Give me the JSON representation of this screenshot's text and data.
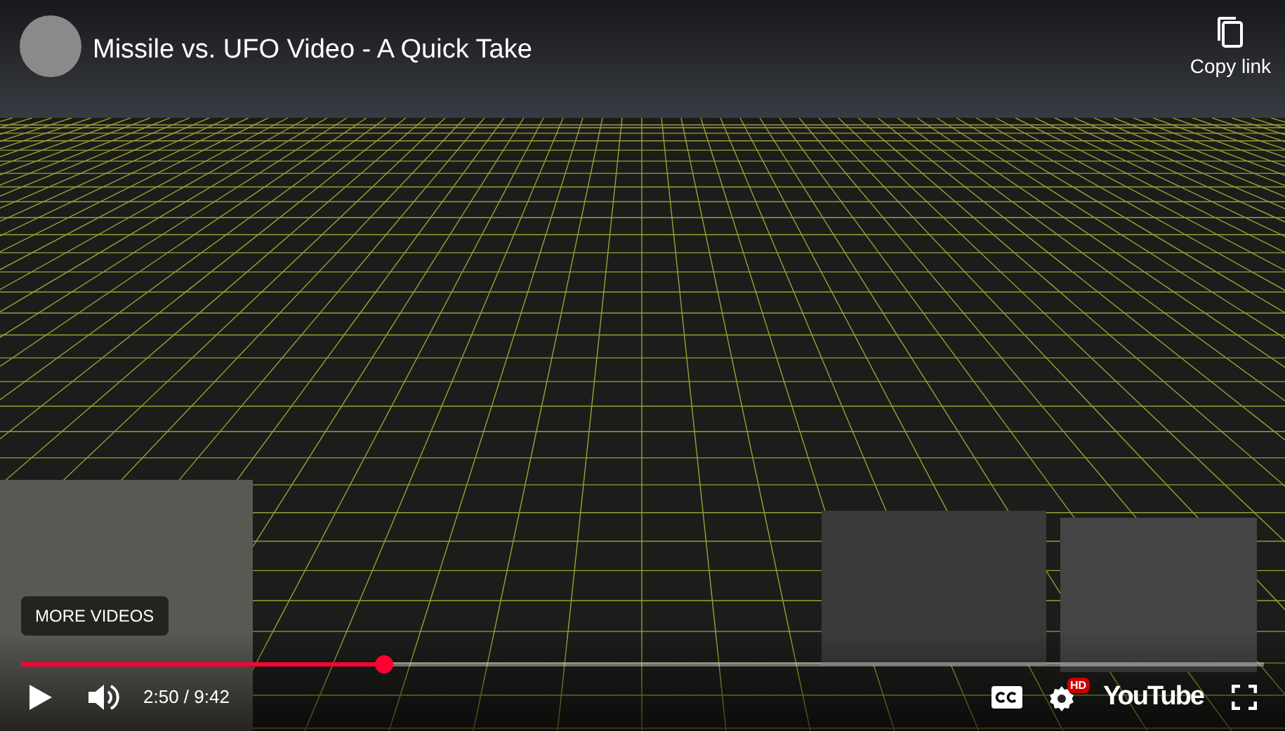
{
  "video": {
    "title": "Missile vs. UFO Video - A Quick Take"
  },
  "share": {
    "label": "Copy link"
  },
  "more_videos": {
    "label": "MORE VIDEOS"
  },
  "progress": {
    "level": 0.292
  },
  "controls": {
    "time": "2:50 / 9:42",
    "quality_badge": "HD",
    "logo": "YouTube"
  }
}
